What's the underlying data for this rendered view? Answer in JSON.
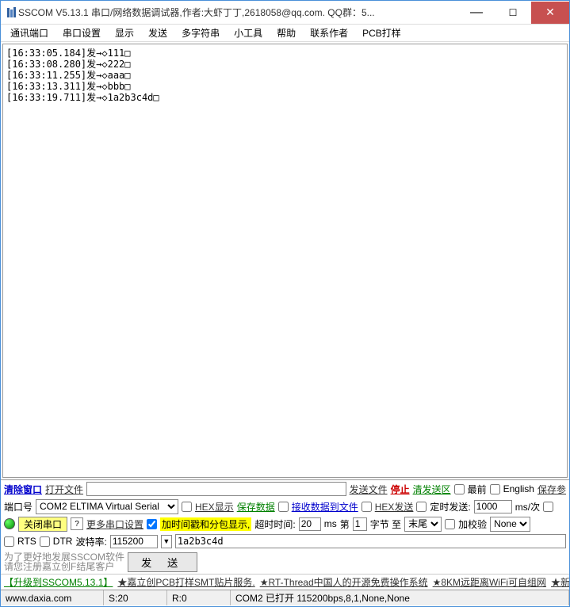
{
  "title": "SSCOM V5.13.1 串口/网络数据调试器,作者:大虾丁丁,2618058@qq.com. QQ群：5...",
  "menu": [
    "通讯端口",
    "串口设置",
    "显示",
    "发送",
    "多字符串",
    "小工具",
    "帮助",
    "联系作者",
    "PCB打样"
  ],
  "output_lines": [
    "[16:33:05.184]发→◇111□",
    "[16:33:08.280]发→◇222□",
    "[16:33:11.255]发→◇aaa□",
    "[16:33:13.311]发→◇bbb□",
    "[16:33:19.711]发→◇1a2b3c4d□"
  ],
  "row1": {
    "clear": "清除窗口",
    "openfile": "打开文件",
    "filepath": "",
    "sendfile": "发送文件",
    "stop": "停止",
    "clearsend": "清发送区",
    "front": "最前",
    "english": "English",
    "savepar": "保存参"
  },
  "row2": {
    "port_label": "端口号",
    "port_value": "COM2 ELTIMA Virtual Serial",
    "hexshow": "HEX显示",
    "savedata": "保存数据",
    "recvtofile": "接收数据到文件",
    "hexsend": "HEX发送",
    "timedsend": "定时发送:",
    "interval": "1000",
    "mstime": "ms/次"
  },
  "row3": {
    "closeport": "关闭串口",
    "moreset": "更多串口设置",
    "timestamp": "加时间戳和分包显示,",
    "timeout_label": "超时时间:",
    "timeout": "20",
    "ms": "ms",
    "di": "第",
    "byte_n": "1",
    "byte_label": "字节 至",
    "tail": "末尾",
    "checksum": "加校验",
    "checktype": "None"
  },
  "row4": {
    "rts": "RTS",
    "dtr": "DTR",
    "baud_label": "波特率:",
    "baud": "115200",
    "sendtext": "1a2b3c4d"
  },
  "row5": {
    "grey1": "为了更好地发展SSCOM软件",
    "grey2": "请您注册嘉立创F结尾客户",
    "send": "发  送"
  },
  "promo": {
    "upgrade": "【升级到SSCOM5.13.1】",
    "p1": "★嘉立创PCB打样SMT贴片服务.",
    "p2": "★RT-Thread中国人的开源免费操作系统",
    "p3": "★8KM远距离WiFi可自组网",
    "p4": "★新一代"
  },
  "status": {
    "url": "www.daxia.com",
    "s": "S:20",
    "r": "R:0",
    "info": "COM2 已打开  115200bps,8,1,None,None"
  }
}
